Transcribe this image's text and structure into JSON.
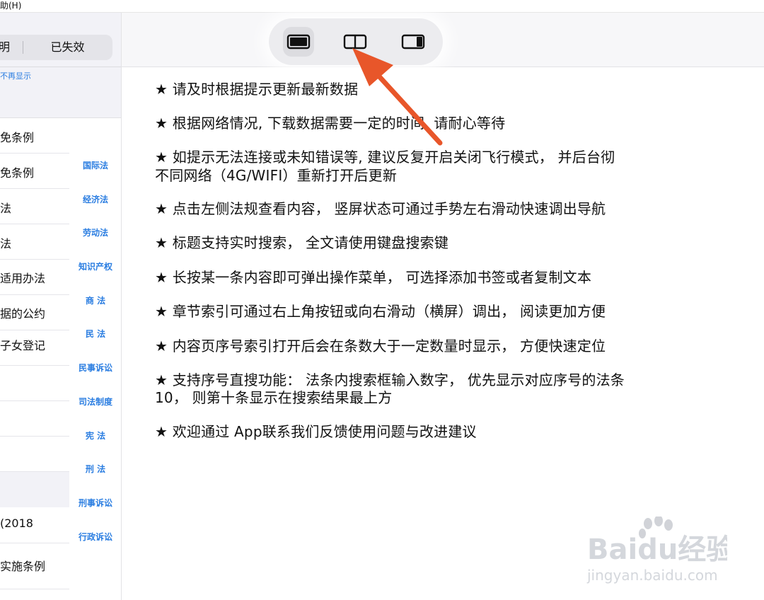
{
  "menu": {
    "help_label": "助(H)"
  },
  "sidebar": {
    "segments": {
      "left": "明",
      "right": "已失效"
    },
    "notice": "不再显示",
    "laws": [
      {
        "label": "免条例"
      },
      {
        "label": "免条例"
      },
      {
        "label": "法"
      },
      {
        "label": "法"
      },
      {
        "label": "适用办法"
      },
      {
        "label": "据的公约"
      },
      {
        "label": "子女登记"
      },
      {
        "label": ""
      },
      {
        "label": ""
      },
      {
        "label": ""
      },
      {
        "label": "(2018"
      },
      {
        "label": "实施条例"
      }
    ],
    "index": [
      "国际法",
      "经济法",
      "劳动法",
      "知识产权",
      "商  法",
      "民  法",
      "民事诉讼",
      "司法制度",
      "宪  法",
      "刑  法",
      "刑事诉讼",
      "行政诉讼"
    ]
  },
  "view_switcher": {
    "buttons": [
      {
        "name": "full-screen-view",
        "icon": "single-pane-icon",
        "active": true
      },
      {
        "name": "split-view",
        "icon": "split-pane-icon",
        "active": false
      },
      {
        "name": "sidebar-view",
        "icon": "right-pane-icon",
        "active": false
      }
    ]
  },
  "tips": [
    {
      "line1": "请及时根据提示更新最新数据"
    },
    {
      "line1": "根据网络情况, 下载数据需要一定的时间, 请耐心等待"
    },
    {
      "line1": "如提示无法连接或未知错误等, 建议反复开启关闭飞行模式， 并后台彻",
      "line2": "不同网络（4G/WIFI）重新打开后更新"
    },
    {
      "line1": "点击左侧法规查看内容， 竖屏状态可通过手势左右滑动快速调出导航"
    },
    {
      "line1": "标题支持实时搜索， 全文请使用键盘搜索键"
    },
    {
      "line1": "长按某一条内容即可弹出操作菜单， 可选择添加书签或者复制文本"
    },
    {
      "line1": "章节索引可通过右上角按钮或向右滑动（横屏）调出， 阅读更加方便"
    },
    {
      "line1": "内容页序号索引打开后会在条数大于一定数量时显示， 方便快速定位"
    },
    {
      "line1": "支持序号直搜功能： 法条内搜索框输入数字， 优先显示对应序号的法条",
      "line2": "10， 则第十条显示在搜索结果最上方"
    },
    {
      "line1": "欢迎通过 App联系我们反馈使用问题与改进建议"
    }
  ],
  "annotation": {
    "arrow_color": "#e8562a"
  },
  "watermark": {
    "brand": "Baidu经验",
    "url": "jingyan.baidu.com"
  },
  "colors": {
    "link_blue": "#2a7de1",
    "panel_gray": "#f2f2f7"
  }
}
